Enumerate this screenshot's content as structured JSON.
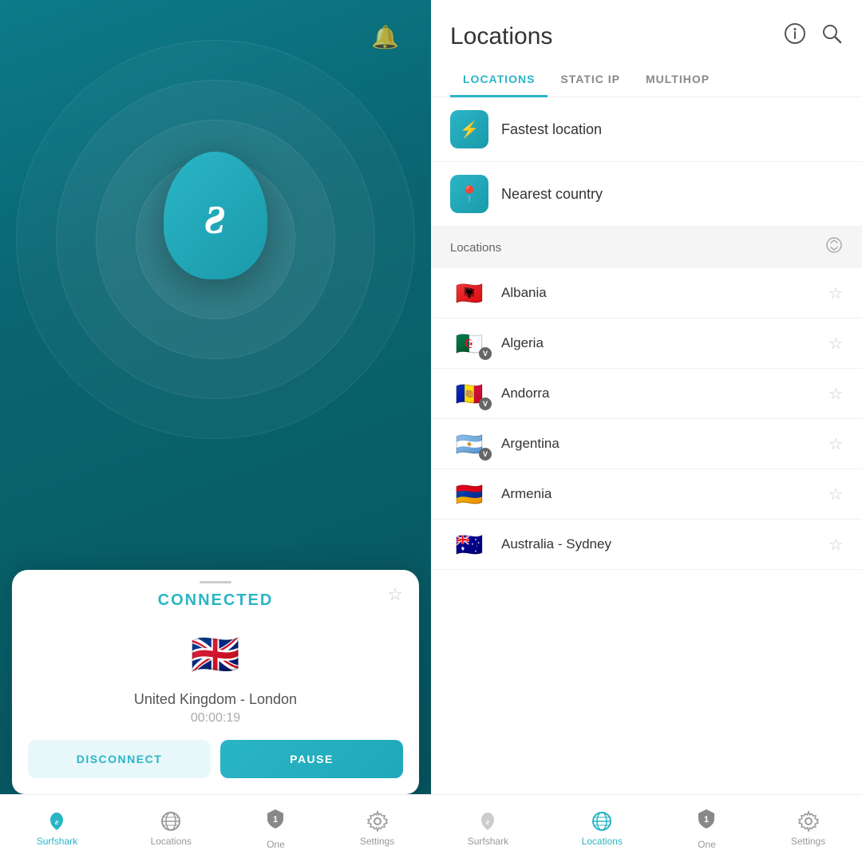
{
  "left": {
    "bell_icon": "🔔",
    "connected_label": "CONNECTED",
    "location": "United Kingdom - London",
    "timer": "00:00:19",
    "disconnect_label": "DISCONNECT",
    "pause_label": "PAUSE",
    "flag_emoji": "🇬🇧",
    "nav": [
      {
        "label": "Surfshark",
        "icon": "surfshark",
        "active": true
      },
      {
        "label": "Locations",
        "icon": "globe",
        "active": false
      },
      {
        "label": "One",
        "icon": "shield",
        "badge": "1",
        "active": false
      },
      {
        "label": "Settings",
        "icon": "gear",
        "active": false
      }
    ]
  },
  "right": {
    "title": "Locations",
    "tabs": [
      {
        "label": "LOCATIONS",
        "active": true
      },
      {
        "label": "STATIC IP",
        "active": false
      },
      {
        "label": "MULTIHOP",
        "active": false
      }
    ],
    "special_items": [
      {
        "label": "Fastest location",
        "icon": "⚡"
      },
      {
        "label": "Nearest country",
        "icon": "📍"
      }
    ],
    "section_label": "Locations",
    "countries": [
      {
        "name": "Albania",
        "flag": "🇦🇱",
        "has_v": false
      },
      {
        "name": "Algeria",
        "flag": "🇩🇿",
        "has_v": true
      },
      {
        "name": "Andorra",
        "flag": "🇦🇩",
        "has_v": true
      },
      {
        "name": "Argentina",
        "flag": "🇦🇷",
        "has_v": true
      },
      {
        "name": "Armenia",
        "flag": "🇦🇲",
        "has_v": false
      },
      {
        "name": "Australia - Sydney",
        "flag": "🇦🇺",
        "has_v": false
      }
    ],
    "nav": [
      {
        "label": "Surfshark",
        "icon": "surfshark",
        "active": false
      },
      {
        "label": "Locations",
        "icon": "globe",
        "active": true
      },
      {
        "label": "One",
        "icon": "shield",
        "badge": "1",
        "active": false
      },
      {
        "label": "Settings",
        "icon": "gear",
        "active": false
      }
    ]
  }
}
